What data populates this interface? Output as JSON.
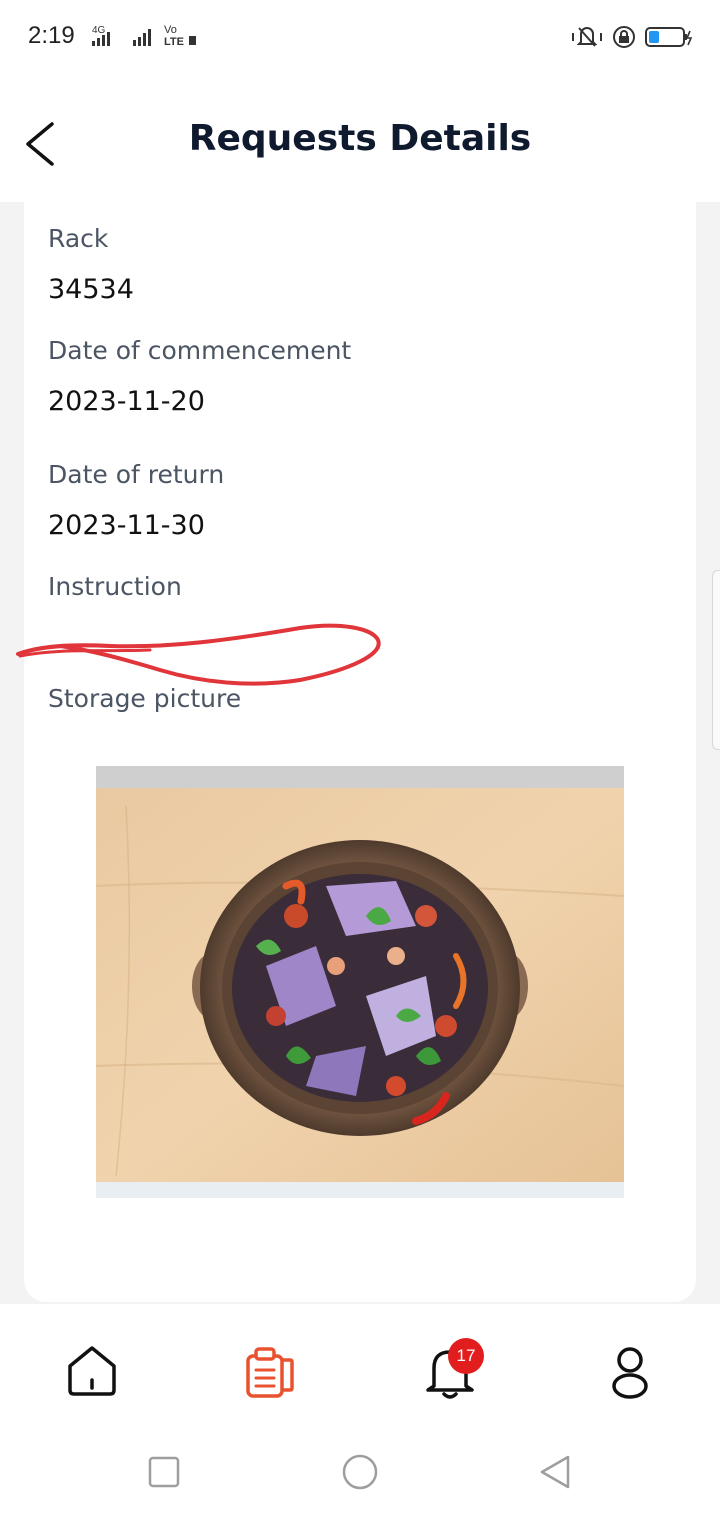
{
  "status_bar": {
    "time": "2:19",
    "network": "4G",
    "volte": "Vo LTE"
  },
  "header": {
    "title": "Requests Details",
    "back_icon": "chevron-left-icon"
  },
  "details": {
    "rack_label": "Rack",
    "rack_value": "34534",
    "commencement_label": "Date of commencement",
    "commencement_value": "2023-11-20",
    "return_label": "Date of return",
    "return_value": "2023-11-30",
    "instruction_label": "Instruction",
    "storage_label": "Storage picture"
  },
  "bottom_nav": {
    "items": [
      {
        "name": "home",
        "icon": "home-icon"
      },
      {
        "name": "requests",
        "icon": "clipboard-icon",
        "active": true
      },
      {
        "name": "notifications",
        "icon": "bell-icon",
        "badge": "17"
      },
      {
        "name": "profile",
        "icon": "user-icon"
      }
    ]
  },
  "colors": {
    "accent": "#e8522e",
    "badge": "#e11d1d",
    "title": "#0f1a2e",
    "scribble": "#e0353a"
  }
}
